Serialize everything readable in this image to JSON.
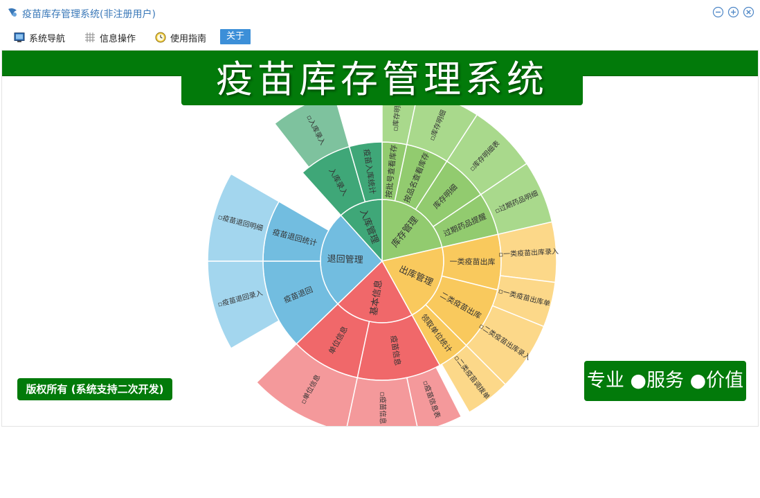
{
  "window": {
    "title": "疫苗库存管理系统(非注册用户)",
    "controls": [
      "minimize-icon",
      "maximize-icon",
      "close-icon"
    ]
  },
  "menu": {
    "items": [
      {
        "label": "系统导航",
        "icon": "monitor-icon"
      },
      {
        "label": "信息操作",
        "icon": "grid-icon"
      },
      {
        "label": "使用指南",
        "icon": "clock-icon"
      }
    ],
    "about": "关于"
  },
  "banner": "疫苗库存管理系统",
  "copyright": "版权所有 (系统支持二次开发)",
  "slogan": "专业 ●服务 ●价值",
  "colors": {
    "brand_green": "#027a0a",
    "kucun": "#92cb6f",
    "chuku": "#f9c95d",
    "jiben": "#f0686a",
    "tuihui": "#72bde0",
    "ruku": "#3fa778"
  },
  "sunburst": {
    "categories": [
      {
        "label": "库存管理",
        "color": "#92cb6f",
        "light": "#a9d98c",
        "children": [
          {
            "label": "按批号查看库存",
            "leaves": [
              "库存明细"
            ]
          },
          {
            "label": "按品名查看库存",
            "leaves": [
              "库存明细"
            ]
          },
          {
            "label": "库存明细",
            "leaves": [
              "库存明细表"
            ]
          },
          {
            "label": "过期药品提醒",
            "leaves": [
              "过期药品明细"
            ]
          }
        ]
      },
      {
        "label": "出库管理",
        "color": "#f9c95d",
        "light": "#fcd889",
        "children": [
          {
            "label": "一类疫苗出库",
            "leaves": [
              "一类疫苗出库录入",
              "一类疫苗出库单"
            ]
          },
          {
            "label": "二类疫苗出库",
            "leaves": [
              "二类疫苗出库录入",
              "二类疫苗调拨单"
            ]
          },
          {
            "label": "领取单位统计",
            "leaves": []
          }
        ]
      },
      {
        "label": "基本信息",
        "color": "#f0686a",
        "light": "#f4999b",
        "children": [
          {
            "label": "疫苗信息",
            "leaves": [
              "疫苗信息表",
              "疫苗信息"
            ]
          },
          {
            "label": "单位信息",
            "leaves": [
              "单位信息"
            ]
          }
        ]
      },
      {
        "label": "退回管理",
        "color": "#72bde0",
        "light": "#a3d6ee",
        "children": [
          {
            "label": "疫苗退回",
            "leaves": [
              "疫苗退回录入"
            ]
          },
          {
            "label": "疫苗退回统计",
            "leaves": [
              "疫苗退回明细"
            ]
          }
        ]
      },
      {
        "label": "入库管理",
        "color": "#3fa778",
        "light": "#7ec29e",
        "children": [
          {
            "label": "入库录入",
            "leaves": [
              "入库录入"
            ]
          },
          {
            "label": "疫苗入库统计",
            "leaves": []
          }
        ]
      }
    ]
  }
}
